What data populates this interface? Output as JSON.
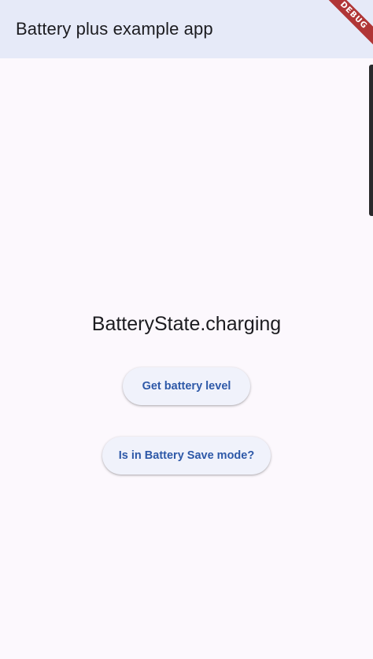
{
  "app_bar": {
    "title": "Battery plus example app",
    "background": "#e6eaf8"
  },
  "debug_banner": {
    "label": "DEBUG",
    "color": "#b03636"
  },
  "main": {
    "battery_state": "BatteryState.charging",
    "buttons": {
      "battery_level_label": "Get battery level",
      "battery_save_label": "Is in Battery Save mode?"
    },
    "accent_color": "#2e59a8"
  }
}
